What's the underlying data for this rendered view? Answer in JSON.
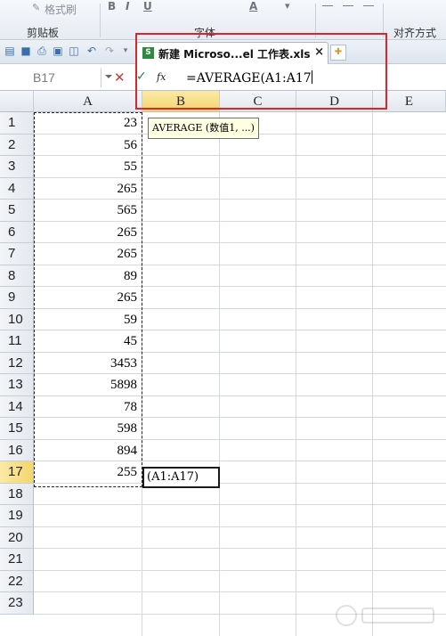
{
  "ribbon": {
    "format_painter": "格式刷",
    "clipboard_group": "剪贴板",
    "font_group": "字体",
    "align_group": "对齐方式",
    "bold": "B",
    "italic": "I",
    "underline": "U",
    "font_color": "A"
  },
  "tab": {
    "icon_letter": "S",
    "title": "新建 Microso...el 工作表.xls",
    "close": "×"
  },
  "formula_bar": {
    "name_box": "B17",
    "cancel": "✕",
    "confirm": "✓",
    "fx": "fx",
    "formula": "=AVERAGE(A1:A17"
  },
  "tooltip": "AVERAGE (数值1, ...)",
  "active_cell_text": "(A1:A17)",
  "columns": [
    "A",
    "B",
    "C",
    "D",
    "E"
  ],
  "rows": [
    "1",
    "2",
    "3",
    "4",
    "5",
    "6",
    "7",
    "8",
    "9",
    "10",
    "11",
    "12",
    "13",
    "14",
    "15",
    "16",
    "17",
    "18",
    "19",
    "20",
    "21",
    "22",
    "23"
  ],
  "column_a_values": [
    "23",
    "56",
    "55",
    "265",
    "565",
    "265",
    "265",
    "89",
    "265",
    "59",
    "45",
    "3453",
    "5898",
    "78",
    "598",
    "894",
    "255"
  ],
  "colors": {
    "highlight": "#d9252b",
    "active_header": "#f3d66b"
  }
}
